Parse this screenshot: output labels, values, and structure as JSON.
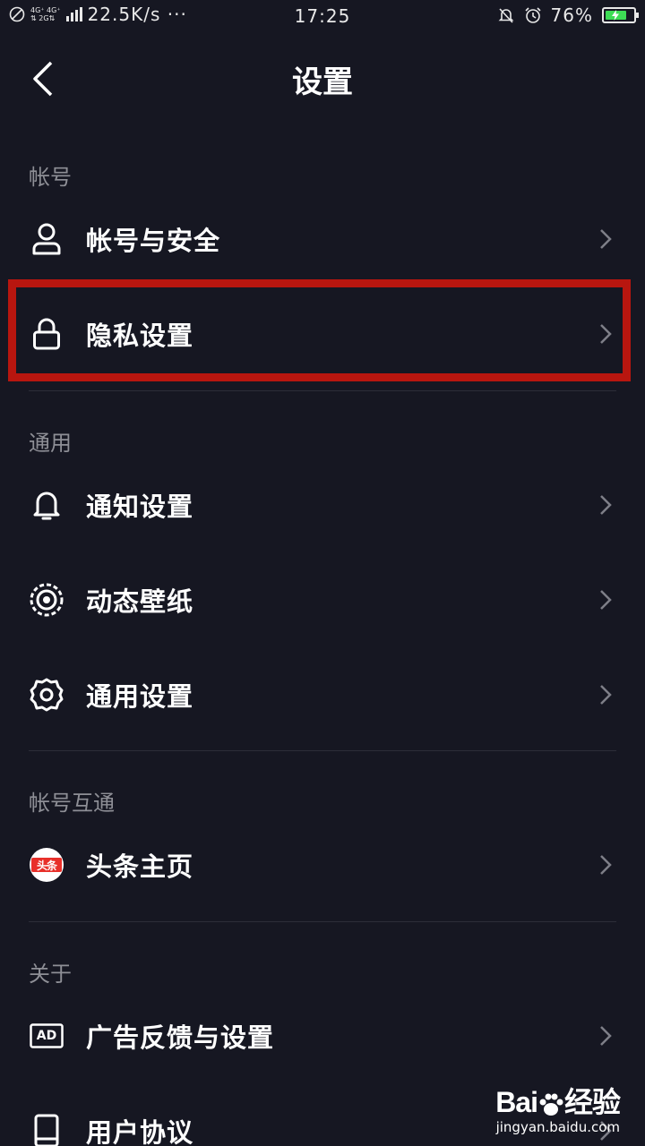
{
  "status_bar": {
    "net_top": "4G⁺ 4G⁺",
    "net_bottom": "⇅ 2G⇅",
    "speed": "22.5K/s ···",
    "time": "17:25",
    "battery_pct": "76%",
    "battery_level": 0.76
  },
  "header": {
    "title": "设置"
  },
  "sections": [
    {
      "label": "帐号",
      "items": [
        {
          "label": "帐号与安全",
          "icon": "user-icon"
        },
        {
          "label": "隐私设置",
          "icon": "lock-icon",
          "highlighted": true
        }
      ]
    },
    {
      "label": "通用",
      "items": [
        {
          "label": "通知设置",
          "icon": "bell-icon"
        },
        {
          "label": "动态壁纸",
          "icon": "live-wallpaper-icon"
        },
        {
          "label": "通用设置",
          "icon": "gear-icon"
        }
      ]
    },
    {
      "label": "帐号互通",
      "items": [
        {
          "label": "头条主页",
          "icon": "toutiao-icon",
          "badge_text": "头条"
        }
      ]
    },
    {
      "label": "关于",
      "items": [
        {
          "label": "广告反馈与设置",
          "icon": "ad-icon",
          "icon_text": "AD"
        },
        {
          "label": "用户协议",
          "icon": "document-icon"
        }
      ]
    }
  ],
  "watermark": {
    "logo_text_left": "Bai",
    "logo_text_right": "经验",
    "url": "jingyan.baidu.com"
  },
  "colors": {
    "background": "#161722",
    "highlight_border": "#b8160f",
    "section_label": "#8e8f96",
    "battery_fill": "#3ddc55",
    "toutiao_red": "#e8302a"
  }
}
